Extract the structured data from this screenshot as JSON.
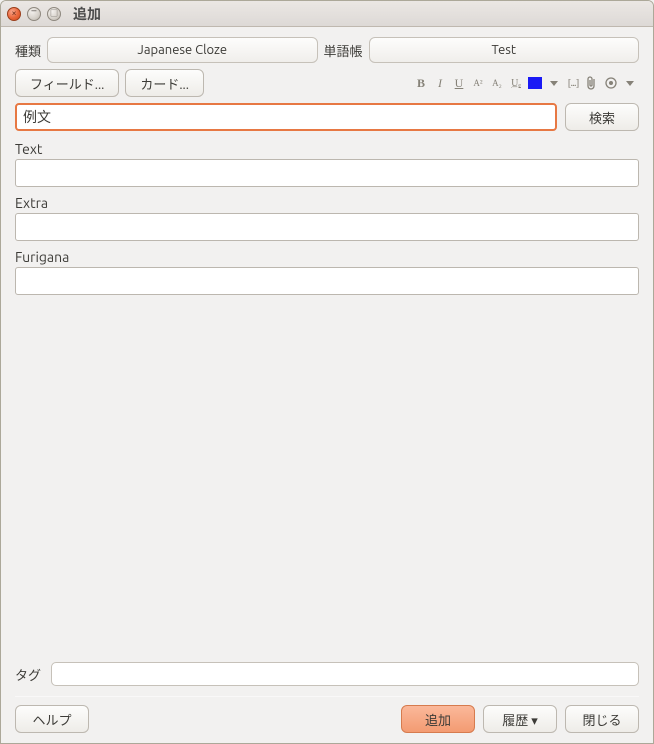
{
  "window": {
    "title": "追加"
  },
  "top": {
    "type_label": "種類",
    "type_value": "Japanese Cloze",
    "deck_label": "単語帳",
    "deck_value": "Test"
  },
  "toolbar": {
    "fields_button": "フィールド...",
    "cards_button": "カード..."
  },
  "format": {
    "bold": "B",
    "italic": "I",
    "underline": "U",
    "superscript": "A²",
    "subscript": "A₂",
    "remove_format": "U̲ₑ",
    "color_hex": "#1a1af5",
    "cloze": "[...]"
  },
  "search": {
    "value": "例文",
    "button": "検索"
  },
  "fields": [
    {
      "name": "Text",
      "value": ""
    },
    {
      "name": "Extra",
      "value": ""
    },
    {
      "name": "Furigana",
      "value": ""
    }
  ],
  "tags": {
    "label": "タグ",
    "value": ""
  },
  "footer": {
    "help": "ヘルプ",
    "add": "追加",
    "history": "履歴 ▾",
    "close": "閉じる"
  }
}
